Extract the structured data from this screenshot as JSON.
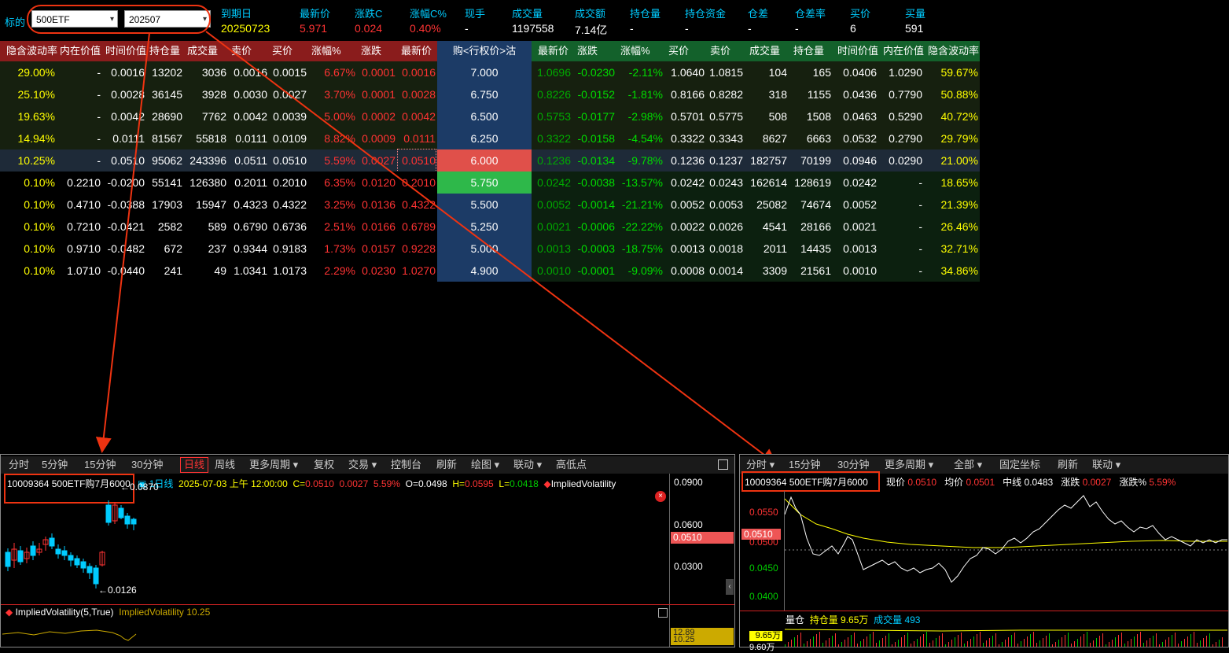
{
  "header": {
    "underlying_label": "标的",
    "underlying_value": "500ETF",
    "month_value": "202507",
    "fields": [
      {
        "label": "到期日",
        "value": "20250723",
        "color": "#ff0"
      },
      {
        "label": "最新价",
        "value": "5.971",
        "color": "#f33"
      },
      {
        "label": "涨跌C",
        "value": "0.024",
        "color": "#f33"
      },
      {
        "label": "涨幅C%",
        "value": "0.40%",
        "color": "#f33"
      },
      {
        "label": "现手",
        "value": "-",
        "color": "#fff"
      },
      {
        "label": "成交量",
        "value": "1197558",
        "color": "#fff"
      },
      {
        "label": "成交额",
        "value": "7.14亿",
        "color": "#fff"
      },
      {
        "label": "持仓量",
        "value": "-",
        "color": "#fff"
      },
      {
        "label": "持仓资金",
        "value": "-",
        "color": "#fff"
      },
      {
        "label": "仓差",
        "value": "-",
        "color": "#fff"
      },
      {
        "label": "仓差率",
        "value": "-",
        "color": "#fff"
      },
      {
        "label": "买价",
        "value": "6",
        "color": "#fff"
      },
      {
        "label": "买量",
        "value": "591",
        "color": "#fff"
      }
    ]
  },
  "table": {
    "call_headers": [
      "隐含波动率",
      "内在价值",
      "时间价值",
      "持仓量",
      "成交量",
      "卖价",
      "买价",
      "涨幅%",
      "涨跌",
      "最新价"
    ],
    "strike_header": "购<行权价>沽",
    "put_headers": [
      "最新价",
      "涨跌",
      "涨幅%",
      "买价",
      "卖价",
      "成交量",
      "持仓量",
      "时间价值",
      "内在价值",
      "隐含波动率"
    ],
    "rows": [
      {
        "call": [
          "29.00%",
          "-",
          "0.0016",
          "13202",
          "3036",
          "0.0016",
          "0.0015",
          "6.67%",
          "0.0001",
          "0.0016"
        ],
        "strike": "7.000",
        "put": [
          "1.0696",
          "-0.0230",
          "-2.11%",
          "1.0640",
          "1.0815",
          "104",
          "165",
          "0.0406",
          "1.0290",
          "59.67%"
        ]
      },
      {
        "call": [
          "25.10%",
          "-",
          "0.0028",
          "36145",
          "3928",
          "0.0030",
          "0.0027",
          "3.70%",
          "0.0001",
          "0.0028"
        ],
        "strike": "6.750",
        "put": [
          "0.8226",
          "-0.0152",
          "-1.81%",
          "0.8166",
          "0.8282",
          "318",
          "1155",
          "0.0436",
          "0.7790",
          "50.88%"
        ]
      },
      {
        "call": [
          "19.63%",
          "-",
          "0.0042",
          "28690",
          "7762",
          "0.0042",
          "0.0039",
          "5.00%",
          "0.0002",
          "0.0042"
        ],
        "strike": "6.500",
        "put": [
          "0.5753",
          "-0.0177",
          "-2.98%",
          "0.5701",
          "0.5775",
          "508",
          "1508",
          "0.0463",
          "0.5290",
          "40.72%"
        ]
      },
      {
        "call": [
          "14.94%",
          "-",
          "0.0111",
          "81567",
          "55818",
          "0.0111",
          "0.0109",
          "8.82%",
          "0.0009",
          "0.0111"
        ],
        "strike": "6.250",
        "put": [
          "0.3322",
          "-0.0158",
          "-4.54%",
          "0.3322",
          "0.3343",
          "8627",
          "6663",
          "0.0532",
          "0.2790",
          "29.79%"
        ]
      },
      {
        "call": [
          "10.25%",
          "-",
          "0.0510",
          "95062",
          "243396",
          "0.0511",
          "0.0510",
          "5.59%",
          "0.0027",
          "0.0510"
        ],
        "strike": "6.000",
        "put": [
          "0.1236",
          "-0.0134",
          "-9.78%",
          "0.1236",
          "0.1237",
          "182757",
          "70199",
          "0.0946",
          "0.0290",
          "21.00%"
        ]
      },
      {
        "call": [
          "0.10%",
          "0.2210",
          "-0.0200",
          "55141",
          "126380",
          "0.2011",
          "0.2010",
          "6.35%",
          "0.0120",
          "0.2010"
        ],
        "strike": "5.750",
        "put": [
          "0.0242",
          "-0.0038",
          "-13.57%",
          "0.0242",
          "0.0243",
          "162614",
          "128619",
          "0.0242",
          "-",
          "18.65%"
        ]
      },
      {
        "call": [
          "0.10%",
          "0.4710",
          "-0.0388",
          "17903",
          "15947",
          "0.4323",
          "0.4322",
          "3.25%",
          "0.0136",
          "0.4322"
        ],
        "strike": "5.500",
        "put": [
          "0.0052",
          "-0.0014",
          "-21.21%",
          "0.0052",
          "0.0053",
          "25082",
          "74674",
          "0.0052",
          "-",
          "21.39%"
        ]
      },
      {
        "call": [
          "0.10%",
          "0.7210",
          "-0.0421",
          "2582",
          "589",
          "0.6790",
          "0.6736",
          "2.51%",
          "0.0166",
          "0.6789"
        ],
        "strike": "5.250",
        "put": [
          "0.0021",
          "-0.0006",
          "-22.22%",
          "0.0022",
          "0.0026",
          "4541",
          "28166",
          "0.0021",
          "-",
          "26.46%"
        ]
      },
      {
        "call": [
          "0.10%",
          "0.9710",
          "-0.0482",
          "672",
          "237",
          "0.9344",
          "0.9183",
          "1.73%",
          "0.0157",
          "0.9228"
        ],
        "strike": "5.000",
        "put": [
          "0.0013",
          "-0.0003",
          "-18.75%",
          "0.0013",
          "0.0018",
          "2011",
          "14435",
          "0.0013",
          "-",
          "32.71%"
        ]
      },
      {
        "call": [
          "0.10%",
          "1.0710",
          "-0.0440",
          "241",
          "49",
          "1.0341",
          "1.0173",
          "2.29%",
          "0.0230",
          "1.0270"
        ],
        "strike": "4.900",
        "put": [
          "0.0010",
          "-0.0001",
          "-9.09%",
          "0.0008",
          "0.0014",
          "3309",
          "21561",
          "0.0010",
          "-",
          "34.86%"
        ]
      }
    ]
  },
  "left_panel": {
    "toolbar": [
      "分时",
      "5分钟",
      "15分钟",
      "30分钟",
      "日线",
      "周线",
      "更多周期 ▾",
      "复权",
      "交易 ▾",
      "控制台",
      "刷新",
      "绘图 ▾",
      "联动 ▾",
      "高低点"
    ],
    "active_tab": "日线",
    "contract": "10009364  500ETF购7月6000",
    "period": "1日线",
    "date": "2025-07-03 上午 12:00:00",
    "c_label": "C=",
    "c_value": "0.0510",
    "chg": "0.0027",
    "pct": "5.59%",
    "o_label": "O=",
    "o_value": "0.0498",
    "h_label": "H=",
    "h_value": "0.0595",
    "l_label": "L=",
    "l_value": "0.0418",
    "indicator": "ImpliedVolatility",
    "y_ticks": [
      "0.0900",
      "0.0600",
      "0.0300"
    ],
    "price_tag": "0.0510",
    "high_label": "0.0870",
    "low_label": "0.0126",
    "sub_title": "ImpliedVolatility(5,True)",
    "sub_value_label": "ImpliedVolatility 10.25",
    "sub_tags": [
      "12.89",
      "10.25"
    ]
  },
  "right_panel": {
    "toolbar": [
      "分时 ▾",
      "15分钟",
      "30分钟",
      "更多周期 ▾",
      "全部 ▾",
      "固定坐标",
      "刷新",
      "联动 ▾"
    ],
    "contract": "10009364  500ETF购7月6000",
    "price_label": "现价",
    "price_value": "0.0510",
    "avg_label": "均价",
    "avg_value": "0.0501",
    "mid_label": "中线",
    "mid_value": "0.0483",
    "chg_label": "涨跌",
    "chg_value": "0.0027",
    "pct_label": "涨跌%",
    "pct_value": "5.59%",
    "y_ticks": [
      "0.0550",
      "0.0500",
      "0.0450",
      "0.0400"
    ],
    "price_tag": "0.0510",
    "vol_line": "量仓",
    "oi_label": "持仓量",
    "oi_value": "9.65万",
    "vol_label": "成交量",
    "vol_value": "493",
    "vol_tags": [
      "9.65万",
      "9.60万"
    ]
  }
}
